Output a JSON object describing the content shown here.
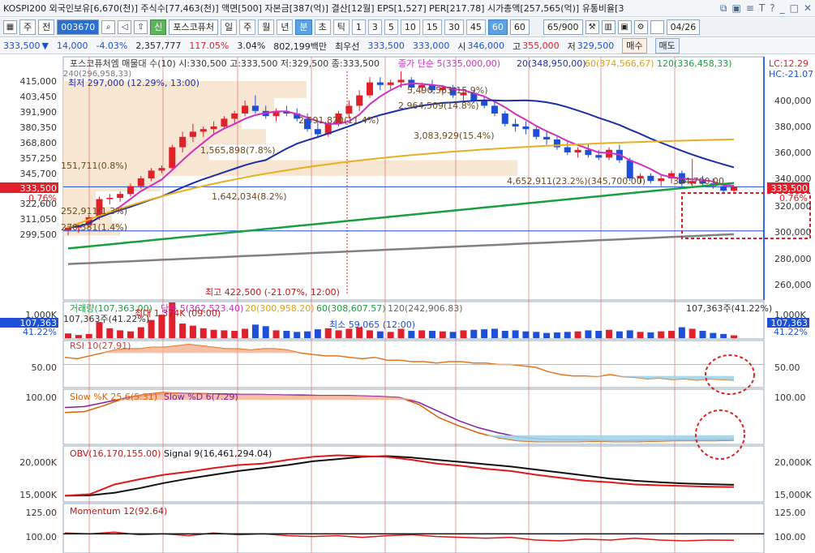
{
  "info_bar": {
    "text": "KOSPI200 외국인보유[6,670(천)] 주식수[77,463(천)] 액면[500] 자본금[387(억)] 결산[12월] EPS[1,527] PER[217.78] 시가총액[257,565(억)] 유통비율[3",
    "icons": [
      "restore-icon",
      "save-icon",
      "menu-icon",
      "help-icon",
      "minimize-icon",
      "maximize-icon",
      "close-icon"
    ],
    "icon_glyphs": [
      "⧉",
      "▣",
      "≡",
      "T",
      "?",
      "_",
      "□",
      "✕"
    ]
  },
  "toolbar": {
    "market": "주",
    "range": "전",
    "code": "003670",
    "name": "포스코퓨처",
    "badge": "신",
    "periods": [
      "일",
      "주",
      "월",
      "년",
      "분",
      "초",
      "틱"
    ],
    "active_period": "분",
    "intervals": [
      "1",
      "3",
      "5",
      "10",
      "15",
      "30",
      "45",
      "60"
    ],
    "active_interval": "60",
    "interval_select": "60",
    "count": "65/900",
    "date": "04/26"
  },
  "quote_bar": {
    "price": "333,500",
    "change_symbol": "▼",
    "change": "14,000",
    "change_pct": "-4.03%",
    "volume": "2,357,777",
    "volume_pct": "117.05%",
    "turnover_pct": "3.04%",
    "amount": "802,199백만",
    "best_label": "최우선",
    "ask": "333,500",
    "bid": "333,000",
    "open_label": "시",
    "open": "346,000",
    "high_label": "고",
    "high": "355,000",
    "low_label": "저",
    "low": "329,500",
    "buy_label": "매수",
    "sell_label": "매도"
  },
  "price_panel": {
    "header": "포스코퓨처엠 매물대 수(10)  시:330,500 고:333,500 저:329,500 종:333,500",
    "ma_label": "종가 단순 5(335,000,00)",
    "ma_legend": [
      {
        "label": "20(348,950,00)",
        "color": "#1c2fa8"
      },
      {
        "label": "60(374,566,67)",
        "color": "#e0a010"
      },
      {
        "label": "120(336,458,33)",
        "color": "#18a040"
      }
    ],
    "ma240_label": "240(296,958,33)",
    "low_label": "최저 297,000 (12.29%, 13:00)",
    "high_label": "최고 422,500 (-21.07%, 12:00)",
    "lc_label": "LC:12.29",
    "hc_label": "HC:-21.07",
    "current_price": "333,500",
    "current_pct": "0.76%",
    "left_ticks": [
      "415,000",
      "403,450",
      "391,900",
      "380,350",
      "368,800",
      "357,250",
      "345,700",
      "322,600",
      "311,050",
      "299,500"
    ],
    "right_ticks": [
      "400,000",
      "380,000",
      "360,000",
      "340,000",
      "320,000",
      "300,000",
      "280,000",
      "260,000"
    ],
    "profile_labels": [
      {
        "text": "151,711(0.8%)"
      },
      {
        "text": "252,911(1.3%)"
      },
      {
        "text": "270,381(1.4%)"
      },
      {
        "text": "1,642,034(8.2%)"
      },
      {
        "text": "1,565,898(7.8%)"
      },
      {
        "text": "2,591,820(11.4%)"
      },
      {
        "text": "2,964,509(14.8%)"
      },
      {
        "text": "3,083,929(15.4%)"
      },
      {
        "text": "5,490,563(15.9%)"
      },
      {
        "text": "4,652,911(23.2%)(345,700.00)"
      },
      {
        "text": "334,700.00"
      }
    ]
  },
  "volume_panel": {
    "legend": "거래량(107,363.00)",
    "ma5": "단순 5(362,523.40)",
    "ma20": "20(300,958.20)",
    "ma60": "60(308,607.57)",
    "ma120": "120(242,906.83)",
    "left_label": "107,363주(41.22%)",
    "right_label": "107,363주(41.22%)",
    "max_label": "최대 1,374K (09:00)",
    "min_label": "최소 59,065 (12:00)",
    "tick": "1,000K",
    "current": "107,363",
    "current_pct": "41.22%"
  },
  "rsi_panel": {
    "label": "RSI 10(27.91)",
    "tick": "50.00"
  },
  "stoch_panel": {
    "k_label": "Slow %K 25,6(5.31)",
    "d_label": "Slow %D 6(7.29)",
    "tick": "100.00"
  },
  "obv_panel": {
    "label": "OBV(16,170,155.00)",
    "signal_label": "Signal 9(16,461,294.04)",
    "ticks": [
      "20,000K",
      "15,000K"
    ]
  },
  "momentum_panel": {
    "label": "Momentum 12(92.64)",
    "ticks": [
      "125.00",
      "100.00"
    ]
  },
  "colors": {
    "up": "#e0202a",
    "down": "#1d4fd8",
    "ma5": "#d030c0",
    "ma20": "#1c2fa8",
    "ma60": "#e8b020",
    "ma120": "#18a040",
    "ma240": "#808080",
    "profile": "#f6e3cc"
  },
  "chart_data": [
    {
      "type": "candlestick",
      "ylim": [
        250000,
        430000
      ],
      "candles": [
        [
          300000,
          304000,
          296000,
          302000
        ],
        [
          302000,
          306000,
          298000,
          304000
        ],
        [
          304000,
          312000,
          302000,
          310000
        ],
        [
          310000,
          326000,
          308000,
          324000
        ],
        [
          324000,
          328000,
          320000,
          325000
        ],
        [
          325000,
          330000,
          322000,
          328000
        ],
        [
          328000,
          336000,
          326000,
          334000
        ],
        [
          334000,
          342000,
          332000,
          340000
        ],
        [
          340000,
          348000,
          338000,
          346000
        ],
        [
          346000,
          350000,
          344000,
          348000
        ],
        [
          348000,
          366000,
          346000,
          364000
        ],
        [
          364000,
          376000,
          360000,
          372000
        ],
        [
          372000,
          382000,
          368000,
          376000
        ],
        [
          376000,
          380000,
          372000,
          378000
        ],
        [
          378000,
          384000,
          374000,
          380000
        ],
        [
          380000,
          388000,
          378000,
          386000
        ],
        [
          386000,
          392000,
          382000,
          390000
        ],
        [
          390000,
          400000,
          388000,
          396000
        ],
        [
          396000,
          404000,
          390000,
          392000
        ],
        [
          392000,
          396000,
          386000,
          388000
        ],
        [
          388000,
          394000,
          384000,
          392000
        ],
        [
          392000,
          396000,
          388000,
          390000
        ],
        [
          390000,
          394000,
          384000,
          386000
        ],
        [
          386000,
          390000,
          376000,
          378000
        ],
        [
          378000,
          384000,
          372000,
          374000
        ],
        [
          374000,
          384000,
          372000,
          382000
        ],
        [
          382000,
          392000,
          380000,
          390000
        ],
        [
          390000,
          400000,
          386000,
          396000
        ],
        [
          396000,
          408000,
          392000,
          404000
        ],
        [
          404000,
          418000,
          402000,
          414000
        ],
        [
          414000,
          418000,
          408000,
          412000
        ],
        [
          412000,
          416000,
          408000,
          414000
        ],
        [
          414000,
          422500,
          410000,
          416000
        ],
        [
          416000,
          418000,
          408000,
          410000
        ],
        [
          410000,
          414000,
          406000,
          412000
        ],
        [
          412000,
          416000,
          406000,
          408000
        ],
        [
          408000,
          412000,
          404000,
          410000
        ],
        [
          410000,
          412000,
          402000,
          404000
        ],
        [
          404000,
          408000,
          400000,
          406000
        ],
        [
          406000,
          408000,
          398000,
          400000
        ],
        [
          400000,
          404000,
          394000,
          396000
        ],
        [
          396000,
          400000,
          388000,
          390000
        ],
        [
          390000,
          392000,
          380000,
          382000
        ],
        [
          382000,
          386000,
          376000,
          380000
        ],
        [
          380000,
          384000,
          374000,
          378000
        ],
        [
          378000,
          380000,
          370000,
          372000
        ],
        [
          372000,
          376000,
          366000,
          370000
        ],
        [
          370000,
          372000,
          362000,
          364000
        ],
        [
          364000,
          368000,
          358000,
          360000
        ],
        [
          360000,
          364000,
          356000,
          362000
        ],
        [
          362000,
          366000,
          356000,
          358000
        ],
        [
          358000,
          362000,
          354000,
          356000
        ],
        [
          356000,
          364000,
          354000,
          362000
        ],
        [
          362000,
          366000,
          352000,
          354000
        ],
        [
          354000,
          356000,
          338000,
          340000
        ],
        [
          340000,
          344000,
          336000,
          342000
        ],
        [
          342000,
          344000,
          336000,
          338000
        ],
        [
          338000,
          342000,
          334000,
          340000
        ],
        [
          340000,
          346000,
          336000,
          344000
        ],
        [
          344000,
          346000,
          334000,
          336000
        ],
        [
          336000,
          355000,
          334000,
          338000
        ],
        [
          338000,
          342000,
          334000,
          336000
        ],
        [
          336000,
          340000,
          332000,
          334000
        ],
        [
          334000,
          336000,
          329500,
          330500
        ],
        [
          330500,
          333500,
          329500,
          333500
        ]
      ]
    },
    {
      "type": "bar",
      "name": "volume",
      "values": [
        180,
        120,
        160,
        620,
        380,
        300,
        260,
        420,
        700,
        900,
        1374,
        560,
        480,
        380,
        320,
        300,
        280,
        360,
        520,
        460,
        300,
        280,
        240,
        260,
        340,
        380,
        300,
        360,
        420,
        300,
        260,
        240,
        360,
        280,
        300,
        280,
        260,
        240,
        300,
        320,
        340,
        360,
        280,
        300,
        260,
        240,
        200,
        220,
        240,
        260,
        300,
        280,
        320,
        260,
        300,
        240,
        220,
        260,
        280,
        420,
        360,
        280,
        200,
        160,
        107
      ]
    },
    {
      "type": "line",
      "name": "RSI",
      "values": [
        60,
        58,
        62,
        66,
        70,
        72,
        72,
        74,
        74,
        76,
        78,
        76,
        74,
        72,
        72,
        70,
        72,
        72,
        70,
        66,
        64,
        62,
        62,
        60,
        58,
        60,
        56,
        56,
        54,
        54,
        52,
        54,
        54,
        52,
        52,
        50,
        50,
        48,
        46,
        40,
        36,
        34,
        34,
        33,
        36,
        33,
        32,
        30,
        31,
        29,
        30,
        28,
        30,
        29,
        28
      ]
    },
    {
      "type": "line",
      "name": "Slow %K",
      "values": [
        60,
        62,
        74,
        88,
        96,
        100,
        98,
        98,
        96,
        96,
        96,
        95,
        94,
        94,
        94,
        93,
        92,
        90,
        76,
        50,
        34,
        20,
        10,
        4,
        2,
        2,
        2,
        3,
        2,
        2,
        3,
        4,
        4,
        4,
        5
      ]
    },
    {
      "type": "line",
      "name": "Slow %D",
      "values": [
        70,
        72,
        80,
        88,
        94,
        97,
        98,
        97,
        97,
        96,
        96,
        95,
        95,
        94,
        94,
        93,
        92,
        90,
        80,
        62,
        44,
        30,
        20,
        12,
        8,
        6,
        6,
        5,
        4,
        5,
        5,
        6,
        6,
        7,
        7
      ]
    },
    {
      "type": "line",
      "name": "OBV",
      "values": [
        15000,
        15200,
        16500,
        17200,
        17800,
        18200,
        18700,
        19100,
        19300,
        19800,
        20200,
        20400,
        20300,
        20200,
        19800,
        19300,
        19000,
        18600,
        18300,
        17800,
        17400,
        17000,
        16800,
        16500,
        16400,
        16300,
        16200,
        16170
      ]
    },
    {
      "type": "line",
      "name": "Signal",
      "values": [
        15000,
        15050,
        15400,
        16000,
        16700,
        17300,
        17800,
        18300,
        18700,
        19100,
        19600,
        19900,
        20200,
        20300,
        20100,
        19800,
        19500,
        19200,
        18900,
        18500,
        18100,
        17700,
        17300,
        17000,
        16800,
        16650,
        16550,
        16461
      ]
    },
    {
      "type": "line",
      "name": "Momentum",
      "values": [
        101,
        100,
        102,
        99,
        100,
        98,
        101,
        99,
        100,
        98,
        97,
        98,
        96,
        98,
        99,
        97,
        96,
        95,
        96,
        93,
        92,
        94,
        93,
        95,
        93,
        92,
        93,
        92.64
      ]
    }
  ]
}
